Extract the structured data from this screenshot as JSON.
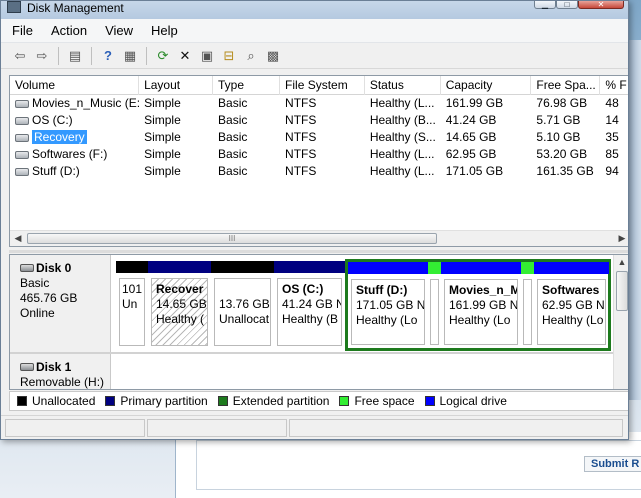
{
  "window": {
    "title": "Disk Management"
  },
  "menu": [
    "File",
    "Action",
    "View",
    "Help"
  ],
  "toolbar": [
    {
      "icon": "back-arrow-icon",
      "glyph": "⇦"
    },
    {
      "icon": "forward-arrow-icon",
      "glyph": "⇨"
    },
    {
      "icon": "console-tree-icon",
      "glyph": "▤"
    },
    {
      "icon": "help-icon",
      "glyph": "?"
    },
    {
      "icon": "show-hide-icon",
      "glyph": "▦"
    },
    {
      "icon": "refresh-icon",
      "glyph": "⟳"
    },
    {
      "icon": "delete-icon",
      "glyph": "✕"
    },
    {
      "icon": "properties-icon",
      "glyph": "▣"
    },
    {
      "icon": "open-folder-icon",
      "glyph": "⊟"
    },
    {
      "icon": "search-icon",
      "glyph": "⌕"
    },
    {
      "icon": "settings-icon",
      "glyph": "▩"
    }
  ],
  "columns": [
    "Volume",
    "Layout",
    "Type",
    "File System",
    "Status",
    "Capacity",
    "Free Spa...",
    "% F"
  ],
  "volumes": [
    {
      "name": "Movies_n_Music (E:)",
      "layout": "Simple",
      "type": "Basic",
      "fs": "NTFS",
      "status": "Healthy (L...",
      "capacity": "161.99 GB",
      "free": "76.98 GB",
      "pct": "48"
    },
    {
      "name": "OS (C:)",
      "layout": "Simple",
      "type": "Basic",
      "fs": "NTFS",
      "status": "Healthy (B...",
      "capacity": "41.24 GB",
      "free": "5.71 GB",
      "pct": "14"
    },
    {
      "name": "Recovery",
      "layout": "Simple",
      "type": "Basic",
      "fs": "NTFS",
      "status": "Healthy (S...",
      "capacity": "14.65 GB",
      "free": "5.10 GB",
      "pct": "35"
    },
    {
      "name": "Softwares (F:)",
      "layout": "Simple",
      "type": "Basic",
      "fs": "NTFS",
      "status": "Healthy (L...",
      "capacity": "62.95 GB",
      "free": "53.20 GB",
      "pct": "85"
    },
    {
      "name": "Stuff (D:)",
      "layout": "Simple",
      "type": "Basic",
      "fs": "NTFS",
      "status": "Healthy (L...",
      "capacity": "171.05 GB",
      "free": "161.35 GB",
      "pct": "94"
    }
  ],
  "scroll_thumb_glyph": "III",
  "disk0": {
    "name": "Disk 0",
    "type": "Basic",
    "size": "465.76 GB",
    "state": "Online"
  },
  "disk1": {
    "name": "Disk 1",
    "type": "Removable (H:)"
  },
  "partitions": {
    "p0": {
      "l1": "101",
      "l2": "Un",
      "bar": "#000000"
    },
    "p1": {
      "name": "Recover",
      "l1": "14.65 GB",
      "l2": "Healthy (",
      "bar": "#000080"
    },
    "p2": {
      "l1": "13.76 GB",
      "l2": "Unallocat",
      "bar": "#000000"
    },
    "p3": {
      "name": "OS  (C:)",
      "l1": "41.24 GB N",
      "l2": "Healthy (B",
      "bar": "#000080"
    },
    "p4": {
      "name": "Stuff  (D:)",
      "l1": "171.05 GB N",
      "l2": "Healthy (Lo",
      "bar": "#0000ff"
    },
    "p5": {
      "name": "Movies_n_M",
      "l1": "161.99 GB N",
      "l2": "Healthy (Lo",
      "bar": "#0000ff"
    },
    "p6": {
      "name": "Softwares",
      "l1": "62.95 GB N",
      "l2": "Healthy (Lo",
      "bar": "#0000ff"
    }
  },
  "legend": [
    {
      "label": "Unallocated",
      "color": "#000000"
    },
    {
      "label": "Primary partition",
      "color": "#000080"
    },
    {
      "label": "Extended partition",
      "color": "#1d7a1d"
    },
    {
      "label": "Free space",
      "color": "#33ee33"
    },
    {
      "label": "Logical drive",
      "color": "#0000ff"
    }
  ],
  "background": {
    "submit_label": "Submit R"
  }
}
